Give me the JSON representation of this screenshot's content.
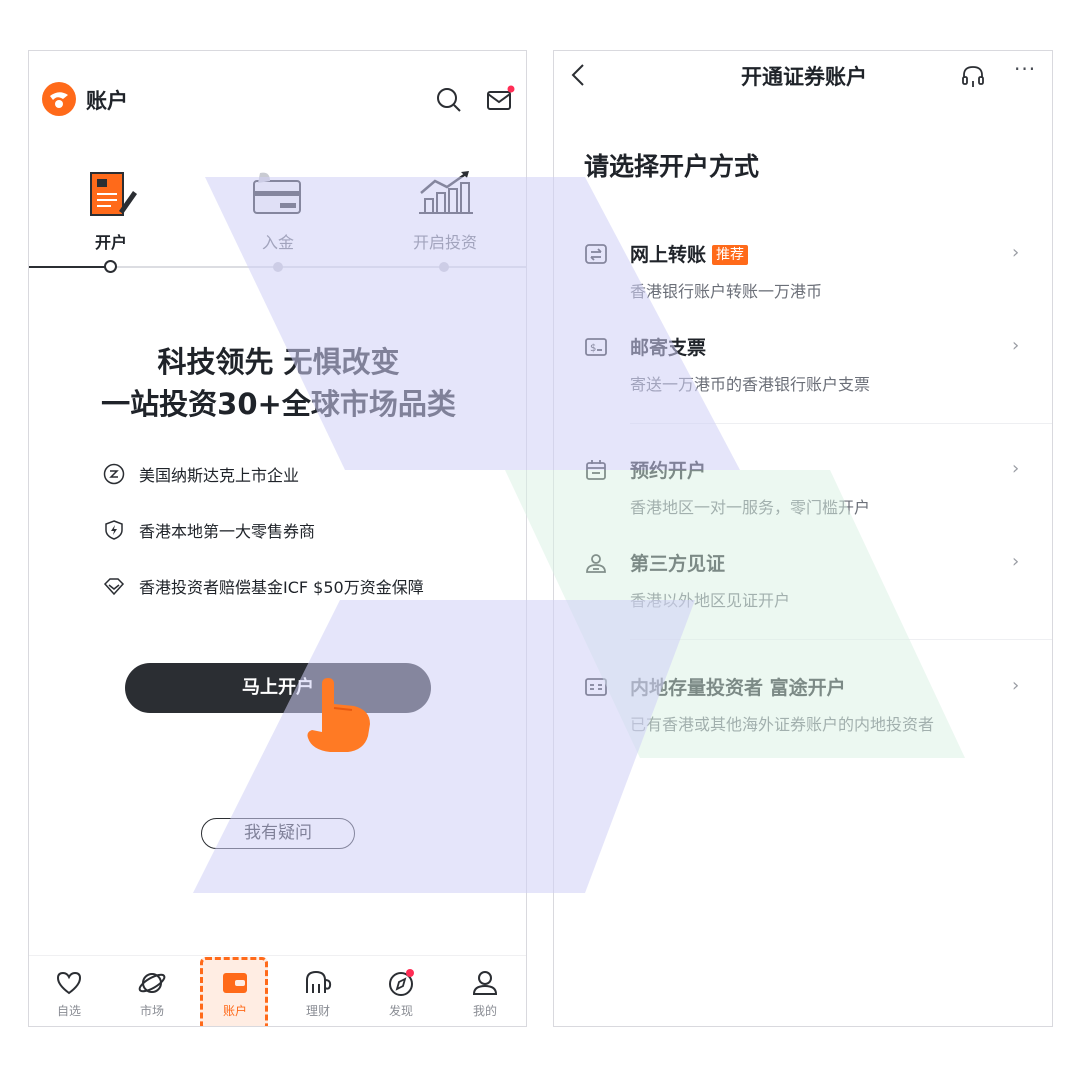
{
  "left": {
    "header": {
      "title": "账户",
      "icons": [
        "logo-icon",
        "search-icon",
        "mail-icon"
      ]
    },
    "steps": [
      {
        "label": "开户",
        "icon": "open-account-icon",
        "active": true
      },
      {
        "label": "入金",
        "icon": "deposit-icon",
        "active": false
      },
      {
        "label": "开启投资",
        "icon": "invest-chart-icon",
        "active": false
      }
    ],
    "headline": {
      "line1": "科技领先 无惧改变",
      "line2": "一站投资30+全球市场品类"
    },
    "features": [
      {
        "text": "美国纳斯达克上市企业",
        "icon": "nasdaq-icon"
      },
      {
        "text": "香港本地第一大零售券商",
        "icon": "shield-bolt-icon"
      },
      {
        "text": "香港投资者赔偿基金ICF $50万资金保障",
        "icon": "diamond-icon"
      }
    ],
    "cta_label": "马上开户",
    "faq_label": "我有疑问",
    "tabbar": [
      {
        "label": "自选",
        "icon": "heart-icon"
      },
      {
        "label": "市场",
        "icon": "planet-icon"
      },
      {
        "label": "账户",
        "icon": "wallet-icon",
        "active": true
      },
      {
        "label": "理财",
        "icon": "elephant-icon"
      },
      {
        "label": "发现",
        "icon": "compass-icon",
        "badge": true
      },
      {
        "label": "我的",
        "icon": "person-icon"
      }
    ]
  },
  "right": {
    "header": {
      "title": "开通证券账户"
    },
    "heading": "请选择开户方式",
    "options": [
      {
        "title": "网上转账",
        "tag": "推荐",
        "subtitle": "香港银行账户转账一万港币",
        "icon": "transfer-icon"
      },
      {
        "title": "邮寄支票",
        "subtitle": "寄送一万港币的香港银行账户支票",
        "icon": "cheque-icon"
      },
      {
        "title": "预约开户",
        "subtitle": "香港地区一对一服务，零门槛开户",
        "icon": "calendar-icon"
      },
      {
        "title": "第三方见证",
        "subtitle": "香港以外地区见证开户",
        "icon": "witness-icon"
      },
      {
        "title": "内地存量投资者 富途开户",
        "subtitle": "已有香港或其他海外证券账户的内地投资者",
        "icon": "id-card-icon"
      }
    ],
    "chevron": "›"
  },
  "colors": {
    "accent": "#ff6a1a",
    "dark": "#2b2e33",
    "overlay_purple": "#dcdcf7",
    "overlay_green": "#e6f6ee"
  }
}
